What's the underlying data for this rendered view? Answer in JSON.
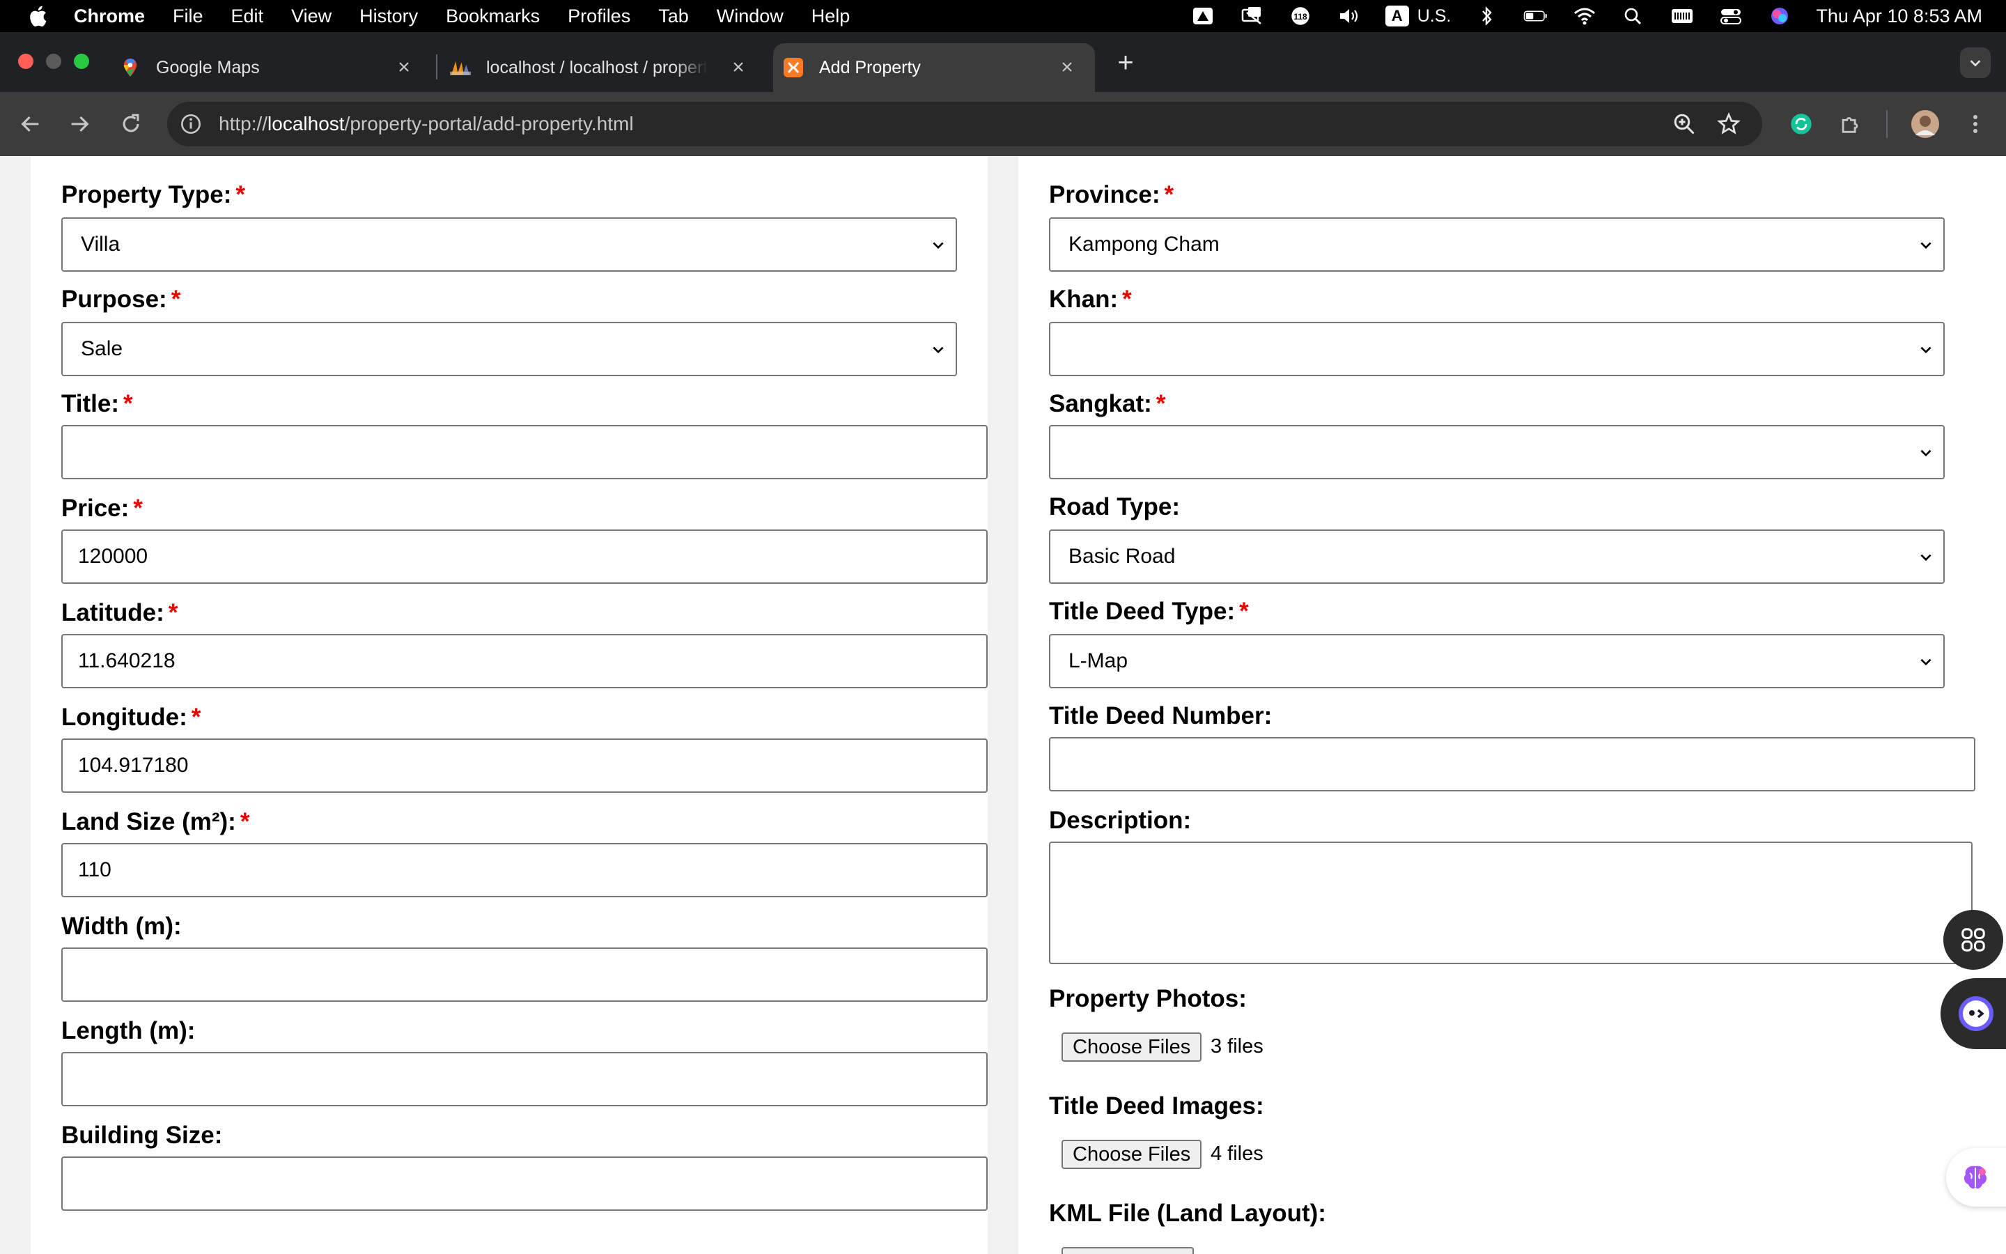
{
  "menubar": {
    "app_name": "Chrome",
    "items": [
      "File",
      "Edit",
      "View",
      "History",
      "Bookmarks",
      "Profiles",
      "Tab",
      "Window",
      "Help"
    ],
    "input_source_letter": "A",
    "input_source": "U.S.",
    "notification_count": "118",
    "clock": "Thu Apr 10  8:53 AM"
  },
  "tabs": [
    {
      "title": "Google Maps",
      "icon": "google-maps-icon",
      "active": false
    },
    {
      "title": "localhost / localhost / propert",
      "icon": "phpmyadmin-icon",
      "active": false
    },
    {
      "title": "Add Property",
      "icon": "xampp-icon",
      "active": true
    }
  ],
  "toolbar": {
    "url_prefix": "http://",
    "url_host": "localhost",
    "url_path": "/property-portal/add-property.html"
  },
  "form_left": {
    "property_type": {
      "label": "Property Type:",
      "value": "Villa"
    },
    "purpose": {
      "label": "Purpose:",
      "value": "Sale"
    },
    "title": {
      "label": "Title:",
      "value": ""
    },
    "price": {
      "label": "Price:",
      "value": "120000"
    },
    "latitude": {
      "label": "Latitude:",
      "value": "11.640218"
    },
    "longitude": {
      "label": "Longitude:",
      "value": "104.917180"
    },
    "land_size": {
      "label": "Land Size (m²):",
      "value": "110"
    },
    "width": {
      "label": "Width (m):",
      "value": ""
    },
    "length": {
      "label": "Length (m):",
      "value": ""
    },
    "building_size": {
      "label": "Building Size:",
      "value": ""
    }
  },
  "form_right": {
    "province": {
      "label": "Province:",
      "value": "Kampong Cham"
    },
    "khan": {
      "label": "Khan:",
      "value": ""
    },
    "sangkat": {
      "label": "Sangkat:",
      "value": ""
    },
    "road_type": {
      "label": "Road Type:",
      "value": "Basic Road"
    },
    "title_deed_type": {
      "label": "Title Deed Type:",
      "value": "L-Map"
    },
    "title_deed_number": {
      "label": "Title Deed Number:",
      "value": ""
    },
    "description": {
      "label": "Description:",
      "value": ""
    },
    "property_photos": {
      "label": "Property Photos:",
      "button": "Choose Files",
      "count": "3 files"
    },
    "title_deed_images": {
      "label": "Title Deed Images:",
      "button": "Choose Files",
      "count": "4 files"
    },
    "kml_file": {
      "label": "KML File (Land Layout):"
    }
  },
  "required_marker": "*",
  "colors": {
    "required": "#e00000",
    "tab_strip": "#202124",
    "toolbar": "#3c3c3c",
    "omnibox": "#282828"
  }
}
